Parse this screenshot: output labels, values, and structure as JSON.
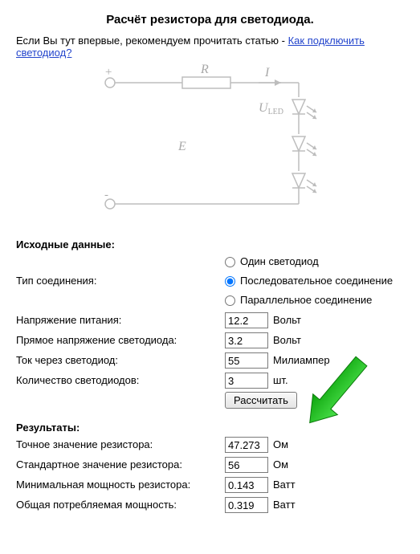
{
  "title": "Расчёт резистора для светодиода.",
  "intro": {
    "prefix": "Если Вы тут впервые, рекомендуем прочитать статью - ",
    "link": "Как подключить светодиод?"
  },
  "diagram": {
    "plus": "+",
    "minus": "-",
    "R": "R",
    "I": "I",
    "E": "E",
    "ULED": "U",
    "ULED_sub": "LED"
  },
  "inputs": {
    "heading": "Исходные данные:",
    "connection_label": "Тип соединения:",
    "connection_options": {
      "single": "Один светодиод",
      "series": "Последовательное соединение",
      "parallel": "Параллельное соединение"
    },
    "connection_selected": "series",
    "supply_label": "Напряжение питания:",
    "supply_value": "12.2",
    "supply_unit": "Вольт",
    "fwd_label": "Прямое напряжение светодиода:",
    "fwd_value": "3.2",
    "fwd_unit": "Вольт",
    "current_label": "Ток через светодиод:",
    "current_value": "55",
    "current_unit": "Милиампер",
    "count_label": "Количество светодиодов:",
    "count_value": "3",
    "count_unit": "шт.",
    "calc_button": "Рассчитать"
  },
  "results": {
    "heading": "Результаты:",
    "exact_r_label": "Точное значение резистора:",
    "exact_r_value": "47.273",
    "exact_r_unit": "Ом",
    "std_r_label": "Стандартное значение резистора:",
    "std_r_value": "56",
    "std_r_unit": "Ом",
    "min_p_label": "Минимальная мощность резистора:",
    "min_p_value": "0.143",
    "min_p_unit": "Ватт",
    "total_p_label": "Общая потребляемая мощность:",
    "total_p_value": "0.319",
    "total_p_unit": "Ватт"
  }
}
